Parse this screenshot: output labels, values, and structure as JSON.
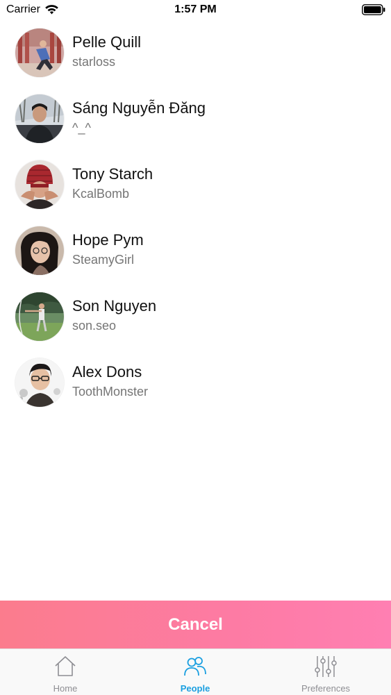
{
  "status_bar": {
    "carrier": "Carrier",
    "time": "1:57 PM",
    "icons": [
      "wifi-icon",
      "battery-icon"
    ]
  },
  "people": [
    {
      "name": "Pelle Quill",
      "handle": "starloss",
      "avatar": "avatar-photo"
    },
    {
      "name": "Sáng Nguyễn Đăng",
      "handle": "^_^",
      "avatar": "avatar-photo"
    },
    {
      "name": "Tony Starch",
      "handle": "KcalBomb",
      "avatar": "avatar-photo"
    },
    {
      "name": "Hope Pym",
      "handle": "SteamyGirl",
      "avatar": "avatar-photo"
    },
    {
      "name": "Son Nguyen",
      "handle": "son.seo",
      "avatar": "avatar-photo"
    },
    {
      "name": "Alex Dons",
      "handle": "ToothMonster",
      "avatar": "avatar-photo"
    }
  ],
  "cancel": {
    "label": "Cancel",
    "gradient": [
      "#fb7c8d",
      "#ff7fb2"
    ]
  },
  "tab_bar": {
    "tabs": [
      {
        "label": "Home",
        "icon": "home-icon",
        "active": false
      },
      {
        "label": "People",
        "icon": "people-icon",
        "active": true
      },
      {
        "label": "Preferences",
        "icon": "sliders-icon",
        "active": false
      }
    ],
    "active_color": "#1a9fe0",
    "inactive_color": "#8e8e93"
  }
}
